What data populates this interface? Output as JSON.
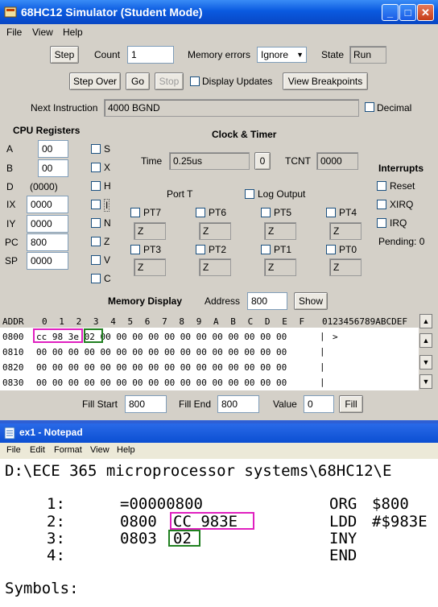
{
  "sim": {
    "title": "68HC12 Simulator (Student Mode)",
    "menu": [
      "File",
      "View",
      "Help"
    ],
    "step_label": "Step",
    "count_label": "Count",
    "count_value": "1",
    "memory_errors_label": "Memory errors",
    "memory_errors_value": "Ignore",
    "state_label": "State",
    "state_value": "Run",
    "step_over_label": "Step Over",
    "go_label": "Go",
    "stop_label": "Stop",
    "display_updates_label": "Display Updates",
    "view_breakpoints_label": "View Breakpoints",
    "next_instruction_label": "Next Instruction",
    "next_instruction_value": "4000  BGND",
    "decimal_label": "Decimal",
    "cpu_registers_label": "CPU Registers",
    "registers": {
      "A": {
        "label": "A",
        "value": "00"
      },
      "B": {
        "label": "B",
        "value": "00"
      },
      "D": {
        "label": "D",
        "value": "(0000)"
      },
      "IX": {
        "label": "IX",
        "value": "0000"
      },
      "IY": {
        "label": "IY",
        "value": "0000"
      },
      "PC": {
        "label": "PC",
        "value": "800"
      },
      "SP": {
        "label": "SP",
        "value": "0000"
      }
    },
    "flags": [
      "S",
      "X",
      "H",
      "I",
      "N",
      "Z",
      "V",
      "C"
    ],
    "clock_timer_label": "Clock & Timer",
    "time_label": "Time",
    "time_value": "0.25us",
    "time_reset_label": "0",
    "tcnt_label": "TCNT",
    "tcnt_value": "0000",
    "interrupts_label": "Interrupts",
    "interrupts": [
      "Reset",
      "XIRQ",
      "IRQ"
    ],
    "pending_label": "Pending: 0",
    "port_t_label": "Port T",
    "log_output_label": "Log Output",
    "port_row1": [
      {
        "label": "PT7",
        "value": "Z"
      },
      {
        "label": "PT6",
        "value": "Z"
      },
      {
        "label": "PT5",
        "value": "Z"
      },
      {
        "label": "PT4",
        "value": "Z"
      }
    ],
    "port_row2": [
      {
        "label": "PT3",
        "value": "Z"
      },
      {
        "label": "PT2",
        "value": "Z"
      },
      {
        "label": "PT1",
        "value": "Z"
      },
      {
        "label": "PT0",
        "value": "Z"
      }
    ],
    "memory_display_label": "Memory Display",
    "address_label": "Address",
    "address_value": "800",
    "show_label": "Show",
    "mem_header": {
      "addr": "ADDR",
      "cols": [
        "0",
        "1",
        "2",
        "3",
        "4",
        "5",
        "6",
        "7",
        "8",
        "9",
        "A",
        "B",
        "C",
        "D",
        "E",
        "F"
      ],
      "ascii": "0123456789ABCDEF"
    },
    "mem_rows": [
      {
        "addr": "0800",
        "bytes": "cc 98 3e 02 00 00 00 00 00 00 00 00 00 00 00 00",
        "ascii": ">"
      },
      {
        "addr": "0810",
        "bytes": "00 00 00 00 00 00 00 00 00 00 00 00 00 00 00 00",
        "ascii": ""
      },
      {
        "addr": "0820",
        "bytes": "00 00 00 00 00 00 00 00 00 00 00 00 00 00 00 00",
        "ascii": ""
      },
      {
        "addr": "0830",
        "bytes": "00 00 00 00 00 00 00 00 00 00 00 00 00 00 00 00",
        "ascii": ""
      }
    ],
    "fill_start_label": "Fill Start",
    "fill_start_value": "800",
    "fill_end_label": "Fill End",
    "fill_end_value": "800",
    "value_label": "Value",
    "value_value": "0",
    "fill_label": "Fill"
  },
  "notepad": {
    "title": "ex1 - Notepad",
    "menu": [
      "File",
      "Edit",
      "Format",
      "View",
      "Help"
    ],
    "path_line": "D:\\ECE 365 microprocessor systems\\68HC12\\E",
    "lines": [
      {
        "num": "1:",
        "addr": "=00000800",
        "code": "",
        "op": "ORG",
        "arg": "$800"
      },
      {
        "num": "2:",
        "addr": "0800",
        "code": "CC 983E",
        "op": "LDD",
        "arg": "#$983E"
      },
      {
        "num": "3:",
        "addr": "0803",
        "code": "02",
        "op": "INY",
        "arg": ""
      },
      {
        "num": "4:",
        "addr": "",
        "code": "",
        "op": "END",
        "arg": ""
      }
    ],
    "symbols_label": "Symbols:"
  },
  "colors": {
    "highlight_magenta": "#e020c0",
    "highlight_green": "#208020",
    "titlebar_blue": "#0a5ae0"
  }
}
